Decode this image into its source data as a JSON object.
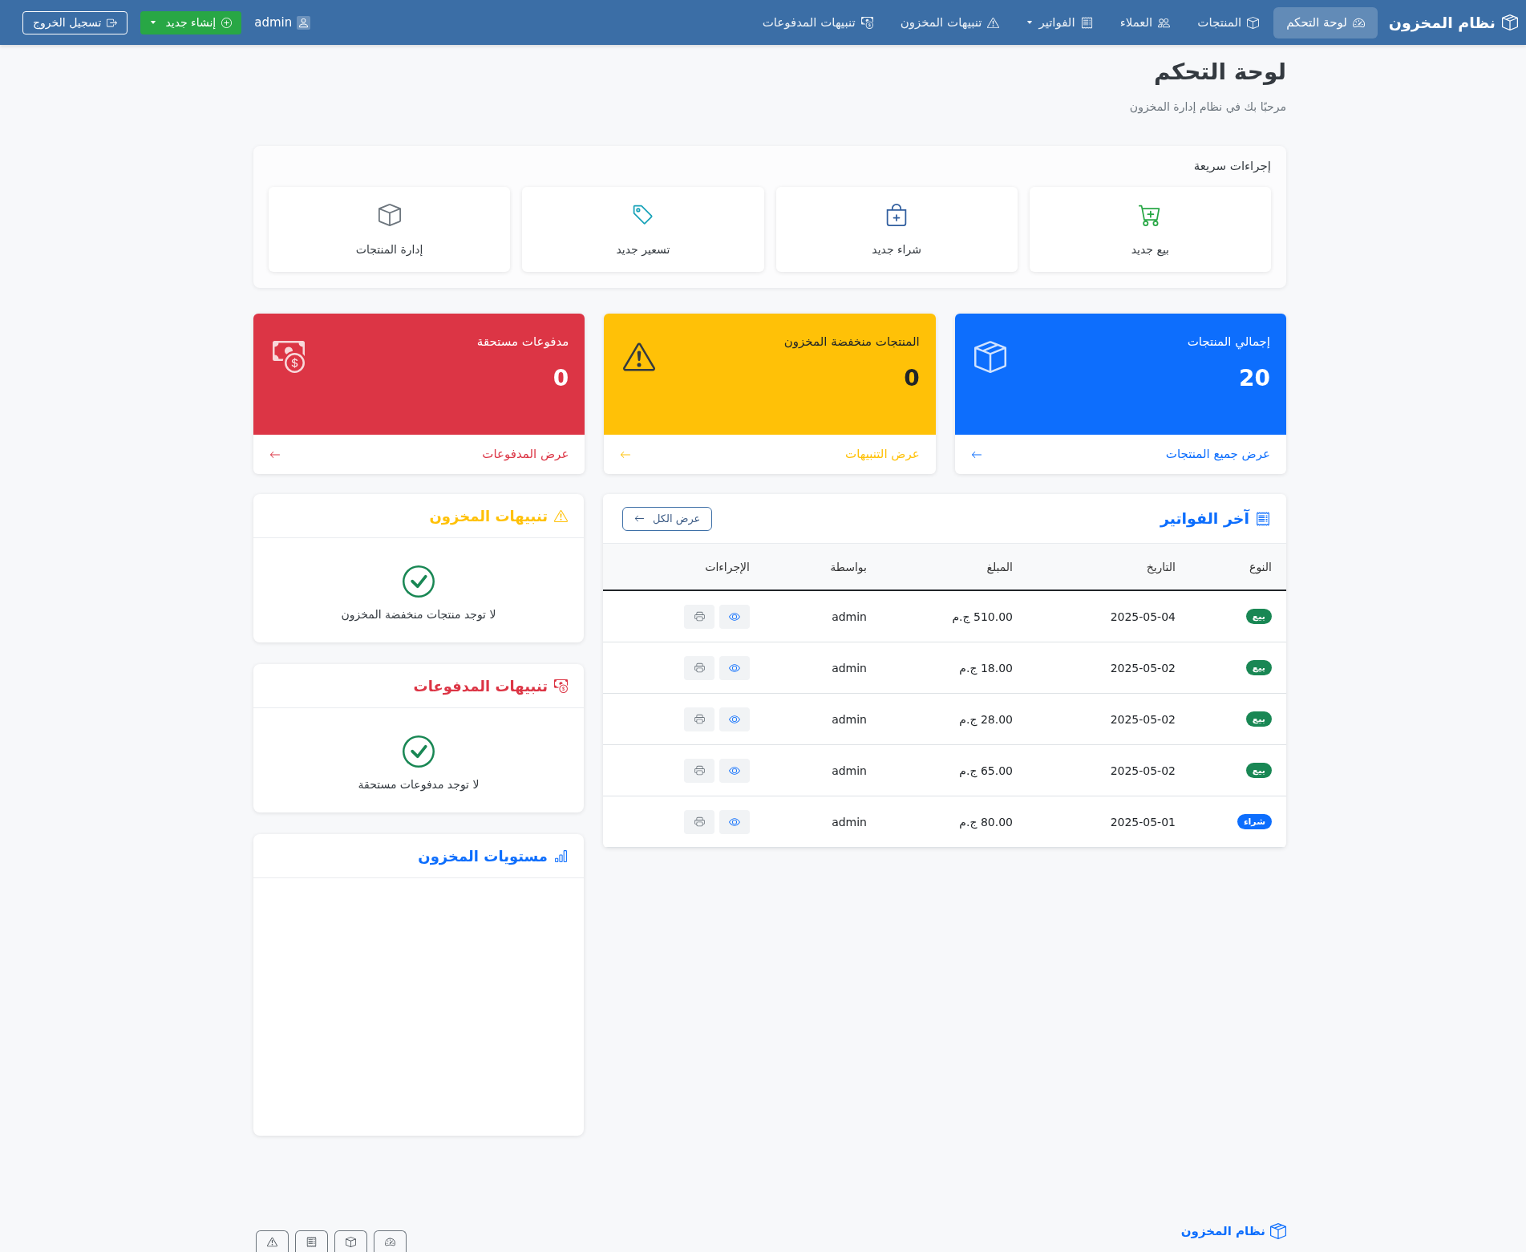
{
  "navbar": {
    "brand": "نظام المخزون",
    "items": [
      {
        "label": "لوحة التحكم",
        "selected": true,
        "dropdown": false
      },
      {
        "label": "المنتجات",
        "selected": false,
        "dropdown": false
      },
      {
        "label": "العملاء",
        "selected": false,
        "dropdown": false
      },
      {
        "label": "الفواتير",
        "selected": false,
        "dropdown": true
      },
      {
        "label": "تنبيهات المخزون",
        "selected": false,
        "dropdown": false
      },
      {
        "label": "تنبيهات المدفوعات",
        "selected": false,
        "dropdown": false
      }
    ],
    "user": "admin",
    "create_button": {
      "label": "إنشاء جديد",
      "dropdown": true
    },
    "logout_button": "تسجيل الخروج"
  },
  "header": {
    "title": "لوحة التحكم",
    "subtitle": "مرحبًا بك في نظام إدارة المخزون"
  },
  "quick_actions": {
    "title": "إجراءات سريعة",
    "items": [
      {
        "label": "بيع جديد",
        "color": "#28a745"
      },
      {
        "label": "شراء جديد",
        "color": "#2f5d9e"
      },
      {
        "label": "تسعير جديد",
        "color": "#17a2b8"
      },
      {
        "label": "إدارة المنتجات",
        "color": "#6c757d"
      }
    ]
  },
  "stat_cards": [
    {
      "title": "إجمالي المنتجات",
      "value": "20",
      "link": "عرض جميع المنتجات",
      "color": "#0d6efd"
    },
    {
      "title": "المنتجات منخفضة المخزون",
      "value": "0",
      "link": "عرض التنبيهات",
      "color": "#ffc107"
    },
    {
      "title": "مدفوعات مستحقة",
      "value": "0",
      "link": "عرض المدفوعات",
      "color": "#dc3545"
    }
  ],
  "latest_invoices": {
    "title": "آخر الفواتير",
    "view_all_button": "عرض الكل",
    "columns": [
      "النوع",
      "التاريخ",
      "المبلغ",
      "بواسطة",
      "الإجراءات"
    ],
    "rows": [
      {
        "type": {
          "label": "بيع",
          "color": "#198754"
        },
        "date": "2025-05-04",
        "amount": "510.00 ج.م",
        "by": "admin"
      },
      {
        "type": {
          "label": "بيع",
          "color": "#198754"
        },
        "date": "2025-05-02",
        "amount": "18.00 ج.م",
        "by": "admin"
      },
      {
        "type": {
          "label": "بيع",
          "color": "#198754"
        },
        "date": "2025-05-02",
        "amount": "28.00 ج.م",
        "by": "admin"
      },
      {
        "type": {
          "label": "بيع",
          "color": "#198754"
        },
        "date": "2025-05-02",
        "amount": "65.00 ج.م",
        "by": "admin"
      },
      {
        "type": {
          "label": "شراء",
          "color": "#0d6efd"
        },
        "date": "2025-05-01",
        "amount": "80.00 ج.م",
        "by": "admin"
      }
    ]
  },
  "side_panels": [
    {
      "title": "تنبيهات المخزون",
      "color": "#ffc107",
      "message": "لا توجد منتجات منخفضة المخزون"
    },
    {
      "title": "تنبيهات المدفوعات",
      "color": "#dc3545",
      "message": "لا توجد مدفوعات مستحقة"
    },
    {
      "title": "مستويات المخزون",
      "color": "#0d6efd"
    }
  ],
  "footer": {
    "brand": "نظام المخزون"
  }
}
